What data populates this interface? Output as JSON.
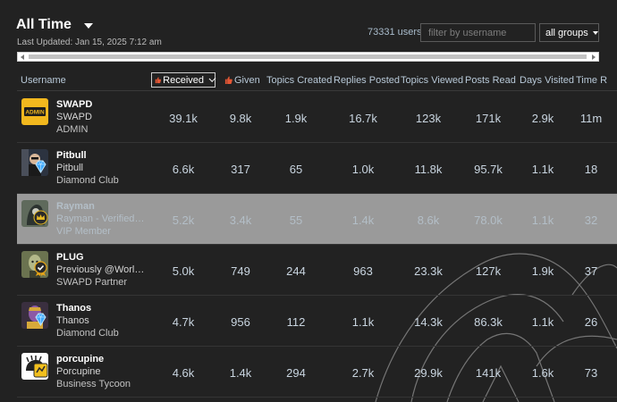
{
  "header": {
    "period": "All Time",
    "last_updated": "Last Updated: Jan 15, 2025 7:12 am",
    "user_count": "73331 users",
    "search_placeholder": "filter by username",
    "group_filter": "all groups"
  },
  "columns": {
    "username": "Username",
    "received": "Received",
    "given": "Given",
    "topics_created": "Topics Created",
    "replies_posted": "Replies Posted",
    "topics_viewed": "Topics Viewed",
    "posts_read": "Posts Read",
    "days_visited": "Days Visited",
    "time_read": "Time R"
  },
  "rows": [
    {
      "name": "SWAPD",
      "title": "SWAPD",
      "group": "ADMIN",
      "avatar": "admin-logo-avatar",
      "flair": "",
      "received": "39.1k",
      "given": "9.8k",
      "topics_created": "1.9k",
      "replies_posted": "16.7k",
      "topics_viewed": "123k",
      "posts_read": "171k",
      "days_visited": "2.9k",
      "time_read": "11m"
    },
    {
      "name": "Pitbull",
      "title": "Pitbull",
      "group": "Diamond Club",
      "avatar": "pitbull-avatar",
      "flair": "diamond-icon",
      "received": "6.6k",
      "given": "317",
      "topics_created": "65",
      "replies_posted": "1.0k",
      "topics_viewed": "11.8k",
      "posts_read": "95.7k",
      "days_visited": "1.1k",
      "time_read": "18"
    },
    {
      "name": "Rayman",
      "title": "Rayman - Verified E...",
      "group": "VIP Member",
      "avatar": "rayman-avatar",
      "flair": "crown-icon",
      "received": "5.2k",
      "given": "3.4k",
      "topics_created": "55",
      "replies_posted": "1.4k",
      "topics_viewed": "8.6k",
      "posts_read": "78.0k",
      "days_visited": "1.1k",
      "time_read": "32"
    },
    {
      "name": "PLUG",
      "title": "Previously @Worlds...",
      "group": "SWAPD Partner",
      "avatar": "plug-avatar",
      "flair": "verified-badge-icon",
      "received": "5.0k",
      "given": "749",
      "topics_created": "244",
      "replies_posted": "963",
      "topics_viewed": "23.3k",
      "posts_read": "127k",
      "days_visited": "1.9k",
      "time_read": "37"
    },
    {
      "name": "Thanos",
      "title": "Thanos",
      "group": "Diamond Club",
      "avatar": "thanos-avatar",
      "flair": "diamond-icon",
      "received": "4.7k",
      "given": "956",
      "topics_created": "112",
      "replies_posted": "1.1k",
      "topics_viewed": "14.3k",
      "posts_read": "86.3k",
      "days_visited": "1.1k",
      "time_read": "26"
    },
    {
      "name": "porcupine",
      "title": "Porcupine",
      "group": "Business Tycoon",
      "avatar": "porcupine-avatar",
      "flair": "tycoon-icon",
      "received": "4.6k",
      "given": "1.4k",
      "topics_created": "294",
      "replies_posted": "2.7k",
      "topics_viewed": "29.9k",
      "posts_read": "141k",
      "days_visited": "1.6k",
      "time_read": "73"
    }
  ],
  "colors": {
    "background": "#222222",
    "highlight_row": "#9a9a9a",
    "link": "#a9bccc",
    "thumb": "#e45735"
  }
}
